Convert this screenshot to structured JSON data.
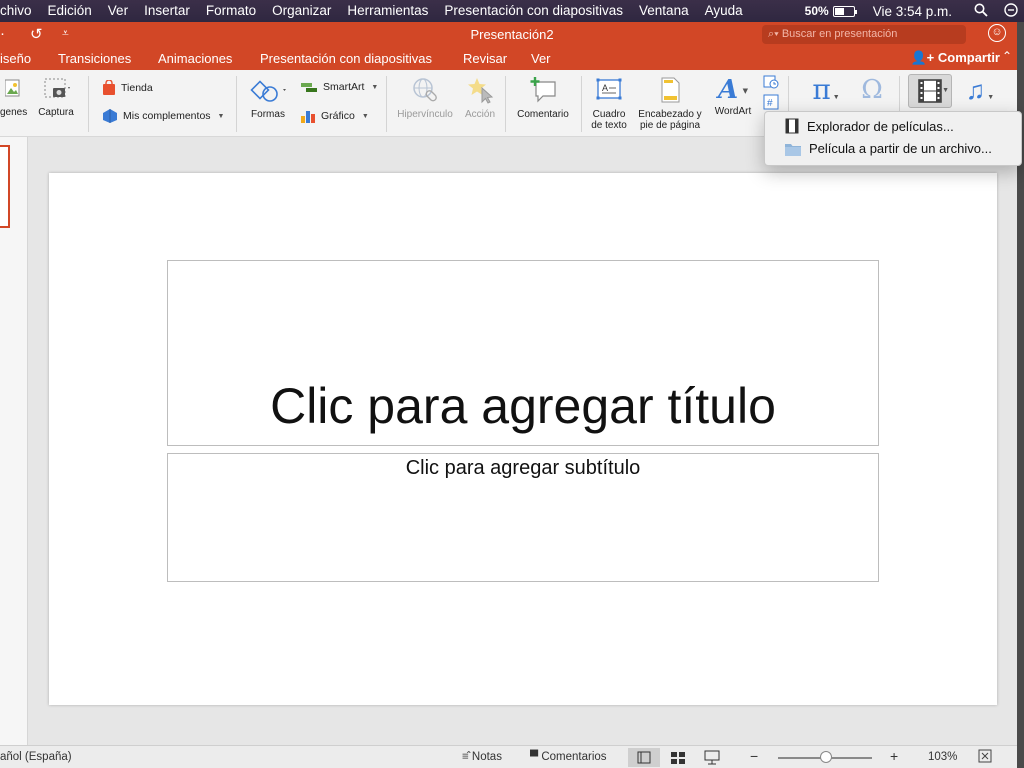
{
  "menubar": {
    "items": [
      "chivo",
      "Edición",
      "Ver",
      "Insertar",
      "Formato",
      "Organizar",
      "Herramientas",
      "Presentación con diapositivas",
      "Ventana",
      "Ayuda"
    ],
    "battery": "50%",
    "clock": "Vie 3:54 p.m."
  },
  "window": {
    "title": "Presentación2",
    "search_placeholder": "Buscar en presentación",
    "share_label": "Compartir"
  },
  "tabs": [
    "iseño",
    "Transiciones",
    "Animaciones",
    "Presentación con diapositivas",
    "Revisar",
    "Ver"
  ],
  "ribbon": {
    "imagenes": "genes",
    "captura": "Captura",
    "tienda": "Tienda",
    "complementos": "Mis complementos",
    "formas": "Formas",
    "smartart": "SmartArt",
    "grafico": "Gráfico",
    "hipervinculo": "Hipervínculo",
    "accion": "Acción",
    "comentario": "Comentario",
    "cuadro_line1": "Cuadro",
    "cuadro_line2": "de texto",
    "encabezado_line1": "Encabezado y",
    "encabezado_line2": "pie de página",
    "wordart": "WordArt"
  },
  "dropdown": {
    "items": [
      "Explorador de películas...",
      "Película a partir de un archivo..."
    ]
  },
  "slide": {
    "title_placeholder": "Clic para agregar título",
    "subtitle_placeholder": "Clic para agregar subtítulo"
  },
  "status": {
    "language": "añol (España)",
    "notas": "Notas",
    "comentarios": "Comentarios",
    "zoom": "103%"
  },
  "colors": {
    "accent": "#d24726"
  }
}
